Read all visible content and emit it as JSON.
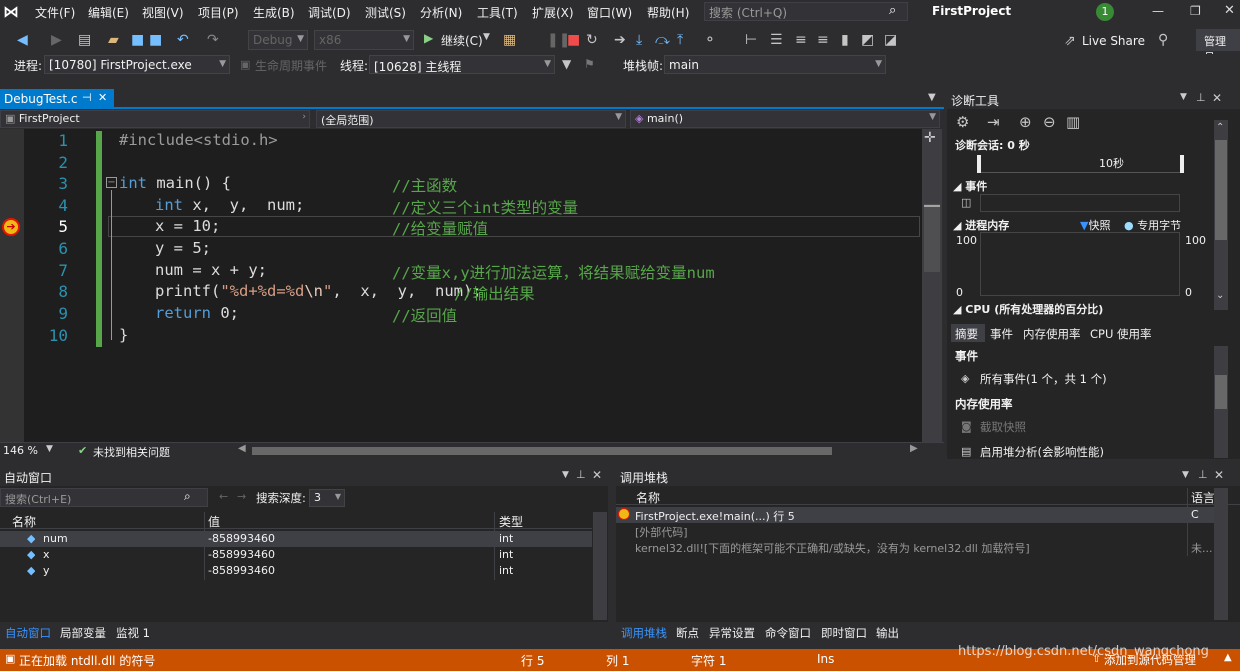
{
  "menu": {
    "items": [
      "文件(F)",
      "编辑(E)",
      "视图(V)",
      "项目(P)",
      "生成(B)",
      "调试(D)",
      "测试(S)",
      "分析(N)",
      "工具(T)",
      "扩展(X)",
      "窗口(W)",
      "帮助(H)"
    ],
    "search_placeholder": "搜索 (Ctrl+Q)",
    "solution_title": "FirstProject",
    "notification_count": "1"
  },
  "toolbar": {
    "config": "Debug",
    "platform": "x86",
    "continue_label": "继续(C)",
    "live_share": "Live Share",
    "admin": "管理员"
  },
  "debug_location": {
    "process_label": "进程:",
    "process_value": "[10780] FirstProject.exe",
    "lifecycle_label": "生命周期事件",
    "thread_label": "线程:",
    "thread_value": "[10628] 主线程",
    "stackframe_label": "堆栈帧:",
    "stackframe_value": "main"
  },
  "editor": {
    "tab_name": "DebugTest.c",
    "nav_project": "FirstProject",
    "nav_scope": "(全局范围)",
    "nav_function": "main()",
    "zoom": "146 %",
    "issues": "未找到相关问题",
    "line_numbers": [
      "1",
      "2",
      "3",
      "4",
      "5",
      "6",
      "7",
      "8",
      "9",
      "10"
    ],
    "code": {
      "l1": "#include<stdio.h>",
      "l3_kw": "int",
      "l3_rest": " main() {",
      "l4_kw": "int",
      "l4_rest": " x,  y,  num;",
      "l5": "x = 10;",
      "l6": "y = 5;",
      "l7": "num = x + y;",
      "l8_a": "printf(",
      "l8_str": "\"%d+%d=%d",
      "l8_esc": "\\n",
      "l8_strend": "\"",
      "l8_b": ",  x,  y,  num);",
      "l9_kw": "return",
      "l9_rest": " 0;",
      "l10": "}"
    },
    "comments": {
      "l3": "//主函数",
      "l4": "//定义三个int类型的变量",
      "l5": "//给变量赋值",
      "l7": "//变量x,y进行加法运算，将结果赋给变量num",
      "l8": "//输出结果",
      "l9": "//返回值"
    }
  },
  "diagnostics": {
    "title": "诊断工具",
    "session": "诊断会话: 0 秒",
    "ruler_label": "10秒",
    "events_header": "事件",
    "memory_header": "进程内存",
    "snapshot_legend": "快照",
    "private_bytes_legend": "专用字节",
    "mem_max_left": "100",
    "mem_min_left": "0",
    "mem_max_right": "100",
    "mem_min_right": "0",
    "cpu_header": "CPU (所有处理器的百分比)",
    "tabs": [
      "摘要",
      "事件",
      "内存使用率",
      "CPU 使用率"
    ],
    "summary_events_title": "事件",
    "all_events": "所有事件(1 个，共 1 个)",
    "memory_usage_title": "内存使用率",
    "take_snapshot": "截取快照",
    "heap_profiling": "启用堆分析(会影响性能)"
  },
  "autos": {
    "title": "自动窗口",
    "search_placeholder": "搜索(Ctrl+E)",
    "depth_label": "搜索深度:",
    "depth_value": "3",
    "columns": [
      "名称",
      "值",
      "类型"
    ],
    "rows": [
      {
        "name": "num",
        "value": "-858993460",
        "type": "int"
      },
      {
        "name": "x",
        "value": "-858993460",
        "type": "int"
      },
      {
        "name": "y",
        "value": "-858993460",
        "type": "int"
      }
    ],
    "bottom_tabs": [
      "自动窗口",
      "局部变量",
      "监视 1"
    ]
  },
  "callstack": {
    "title": "调用堆栈",
    "columns": [
      "名称",
      "语言"
    ],
    "rows": [
      {
        "name": "FirstProject.exe!main(...) 行 5",
        "lang": "C"
      },
      {
        "name": "[外部代码]",
        "lang": ""
      },
      {
        "name": "kernel32.dll![下面的框架可能不正确和/或缺失，没有为 kernel32.dll 加载符号]",
        "lang": "未..."
      }
    ],
    "bottom_tabs": [
      "调用堆栈",
      "断点",
      "异常设置",
      "命令窗口",
      "即时窗口",
      "输出"
    ]
  },
  "status": {
    "message": "正在加载 ntdll.dll 的符号",
    "row": "行 5",
    "col": "列 1",
    "char": "字符 1",
    "mode": "Ins",
    "add_source": "添加到源代码管理",
    "watermark": "https://blog.csdn.net/csdn_wangchong"
  },
  "colors": {
    "accent": "#007acc",
    "status": "#ca5100",
    "comment": "#57a64a",
    "keyword": "#569cd6",
    "linenum": "#2b91af"
  }
}
